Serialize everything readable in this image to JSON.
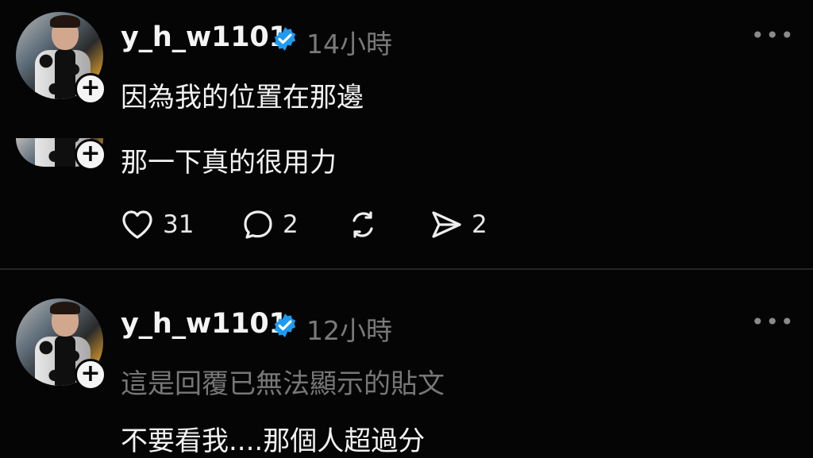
{
  "posts": [
    {
      "username": "y_h_w1101",
      "time": "14小時",
      "text_1": "因為我的位置在那邊",
      "text_2": "那一下真的很用力",
      "actions": {
        "likes": "31",
        "comments": "2",
        "shares": "2"
      }
    },
    {
      "username": "y_h_w1101",
      "time": "12小時",
      "reply_note": "這是回覆已無法顯示的貼文",
      "text": "不要看我....那個人超過分"
    }
  ],
  "colors": {
    "verified": "#1d9bf0",
    "background": "#050505",
    "muted": "#777777"
  },
  "icons": {
    "more": "•••",
    "plus": "+"
  }
}
